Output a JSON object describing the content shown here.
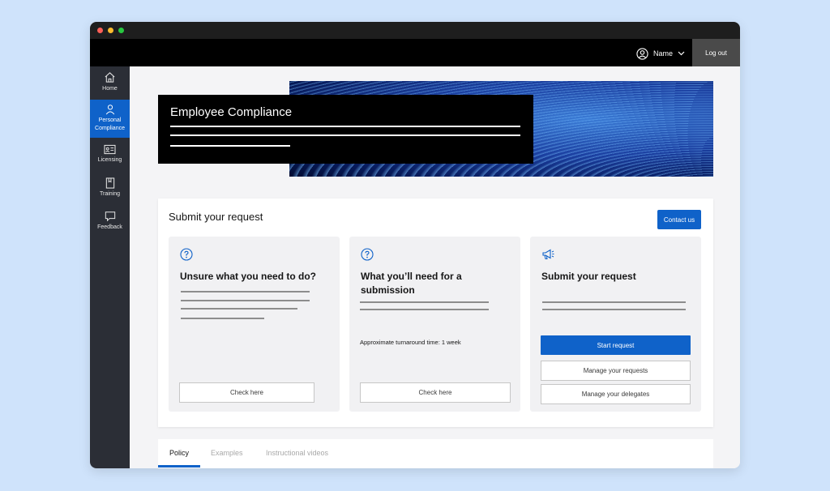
{
  "header": {
    "user_name": "Name",
    "logout_label": "Log out"
  },
  "sidebar": {
    "items": [
      {
        "label": "Home",
        "icon": "home-icon"
      },
      {
        "label": "Personal Compliance",
        "icon": "user-icon",
        "active": true
      },
      {
        "label": "Licensing",
        "icon": "id-card-icon"
      },
      {
        "label": "Training",
        "icon": "book-icon"
      },
      {
        "label": "Feedback",
        "icon": "chat-icon"
      }
    ]
  },
  "hero": {
    "title": "Employee Compliance"
  },
  "request_section": {
    "title": "Submit your request",
    "contact_label": "Contact us",
    "tiles": [
      {
        "icon": "help-icon",
        "title": "Unsure what you need to do?",
        "button": "Check here"
      },
      {
        "icon": "help-icon",
        "title": "What you’ll need for a submission",
        "turnaround": "Approximate turnaround time: 1 week",
        "button": "Check here"
      },
      {
        "icon": "megaphone-icon",
        "title": "Submit your request",
        "primary_button": "Start request",
        "secondary_buttons": [
          "Manage your requests",
          "Manage your delegates"
        ]
      }
    ]
  },
  "tabs": {
    "items": [
      "Policy",
      "Examples",
      "Instructional videos"
    ],
    "active": "Policy"
  },
  "colors": {
    "accent": "#0f62c9",
    "topbar": "#000000",
    "sidebar": "#2b2e36"
  }
}
